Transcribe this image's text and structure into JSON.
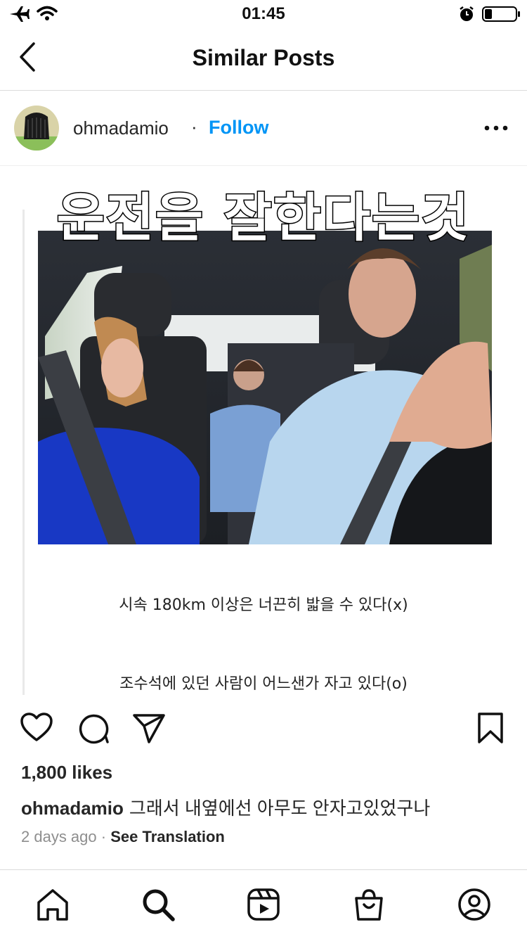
{
  "status_bar": {
    "time": "01:45"
  },
  "header": {
    "title": "Similar Posts"
  },
  "post": {
    "username": "ohmadamio",
    "separator": "·",
    "follow_label": "Follow",
    "media": {
      "headline": "운전을 잘한다는것",
      "line1": "시속 180km 이상은 너끈히 밟을 수 있다(x)",
      "line2": "조수석에 있던 사람이 어느샌가 자고 있다(o)"
    },
    "likes": "1,800 likes",
    "caption_user": "ohmadamio",
    "caption_text": "그래서 내옆에선 아무도 안자고있었구나",
    "time_ago": "2 days ago",
    "meta_sep": "·",
    "see_translation": "See Translation"
  },
  "colors": {
    "accent": "#0095f6",
    "text": "#262626",
    "muted": "#8e8e8e"
  },
  "icons": {
    "status": [
      "airplane-icon",
      "wifi-icon",
      "alarm-icon",
      "battery-icon"
    ],
    "actions": [
      "heart-icon",
      "comment-icon",
      "share-icon",
      "bookmark-icon"
    ],
    "tabs": [
      "home-icon",
      "search-icon",
      "reels-icon",
      "shop-icon",
      "profile-icon"
    ]
  }
}
